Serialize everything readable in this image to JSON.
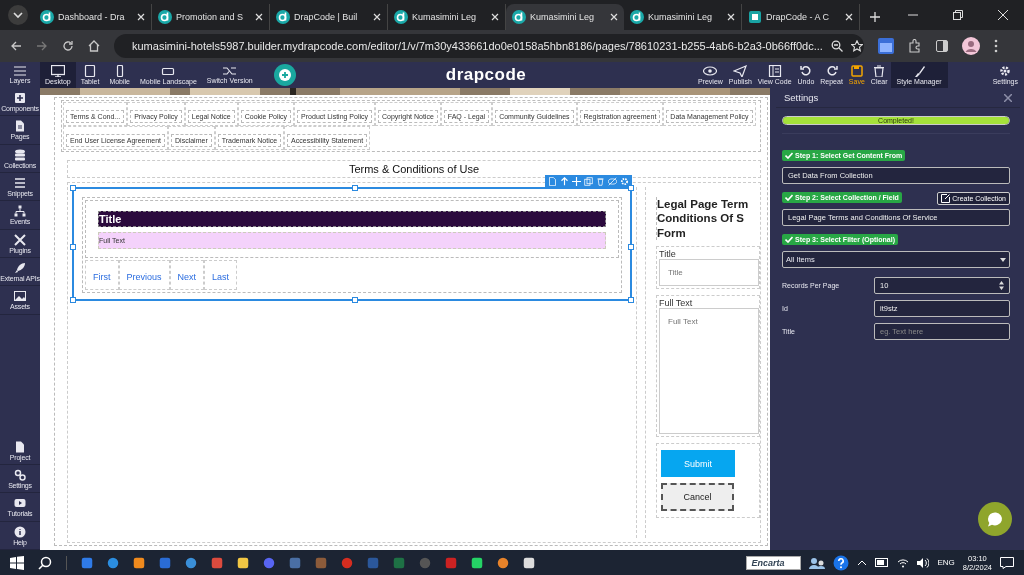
{
  "browser": {
    "tabs": [
      {
        "title": "Dashboard - Dra",
        "selected": false
      },
      {
        "title": "Promotion and S",
        "selected": false
      },
      {
        "title": "DrapCode | Buil",
        "selected": false
      },
      {
        "title": "Kumasimini Leg",
        "selected": false
      },
      {
        "title": "Kumasimini Leg",
        "selected": true
      },
      {
        "title": "Kumasimini Leg",
        "selected": false
      },
      {
        "title": "DrapCode - A C",
        "selected": false
      }
    ],
    "url": "kumasimini-hotels5987.builder.mydrapcode.com/editor/1/v/7m30y433661do0e0158a5hbn8186/pages/78610231-b255-4ab6-b2a3-0b66ff0dc..."
  },
  "editor_toolbar": {
    "layers_label": "Layers",
    "devices": [
      {
        "label": "Desktop",
        "selected": true
      },
      {
        "label": "Tablet",
        "selected": false
      },
      {
        "label": "Mobile",
        "selected": false
      },
      {
        "label": "Mobile Landscape",
        "selected": false
      }
    ],
    "switch_label": "Switch Version",
    "logo": "drapcode",
    "actions": [
      {
        "label": "Preview",
        "highlighted": false,
        "selected": false
      },
      {
        "label": "Publish",
        "highlighted": false,
        "selected": false
      },
      {
        "label": "View Code",
        "highlighted": false,
        "selected": false
      },
      {
        "label": "Undo",
        "highlighted": false,
        "selected": false
      },
      {
        "label": "Repeat",
        "highlighted": false,
        "selected": false
      },
      {
        "label": "Save",
        "highlighted": true,
        "selected": false
      },
      {
        "label": "Clear",
        "highlighted": false,
        "selected": false
      },
      {
        "label": "Style Manager",
        "highlighted": false,
        "selected": true
      }
    ],
    "settings_label": "Settings"
  },
  "sidebar": {
    "items": [
      "Components",
      "Pages",
      "Collections",
      "Snippets",
      "Events",
      "Plugins",
      "External APIs",
      "Assets"
    ],
    "bottom_items": [
      "Project",
      "Settings",
      "Tutorials",
      "Help"
    ]
  },
  "canvas": {
    "nav_links": [
      "Terms & Cond...",
      "Privacy Policy",
      "Legal Notice",
      "Cookie Policy",
      "Product Listing Policy",
      "Copyright Notice",
      "FAQ - Legal",
      "Community Guidelines",
      "Registration agreement",
      "Data Management Policy",
      "End User License Agreement",
      "Disclaimer",
      "Trademark Notice",
      "Accessibility Statement"
    ],
    "heading": "Terms & Conditions of Use",
    "list": {
      "title": "Title",
      "full_text": "Full Text",
      "pagination": [
        "First",
        "Previous",
        "Next",
        "Last"
      ]
    },
    "form": {
      "heading": "Legal Page Term\nConditions Of S\nForm",
      "fields": [
        {
          "label": "Title",
          "placeholder": "Title",
          "kind": "input"
        },
        {
          "label": "Full Text",
          "placeholder": "Full Text",
          "kind": "textarea"
        }
      ],
      "submit": "Submit",
      "cancel": "Cancel"
    }
  },
  "settings_panel": {
    "title": "Settings",
    "progress": {
      "label": "Completed!",
      "level": 1
    },
    "step1": {
      "label": "Step 1: Select Get Content From",
      "value": "Get Data From Collection"
    },
    "step2": {
      "label": "Step 2: Select Collection / Field",
      "button": "Create Collection",
      "value": "Legal Page Terms and Conditions Of Service"
    },
    "step3": {
      "label": "Step 3: Select Filter (Optional)",
      "value": "All Items"
    },
    "fields": [
      {
        "label": "Records Per Page",
        "value": "10",
        "kind": "number"
      },
      {
        "label": "Id",
        "value": "it9stz",
        "kind": "text"
      },
      {
        "label": "Title",
        "placeholder": "eg. Text here",
        "kind": "text"
      }
    ]
  },
  "taskbar": {
    "search_box": "Encarta",
    "language": "ENG",
    "time": "03:10",
    "date": "8/2/2024"
  }
}
